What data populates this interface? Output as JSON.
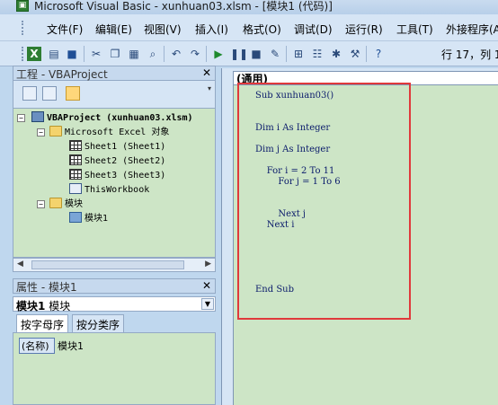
{
  "window": {
    "title": "Microsoft Visual Basic - xunhuan03.xlsm - [模块1 (代码)]"
  },
  "menu": [
    "文件(F)",
    "编辑(E)",
    "视图(V)",
    "插入(I)",
    "格式(O)",
    "调试(D)",
    "运行(R)",
    "工具(T)",
    "外接程序(A)"
  ],
  "toolbar": {
    "icons": [
      "excel-icon",
      "insert-form-icon",
      "save-icon",
      "cut-icon",
      "copy-icon",
      "paste-icon",
      "find-icon",
      "undo-icon",
      "redo-icon",
      "run-icon",
      "break-icon",
      "reset-icon",
      "design-mode-icon",
      "project-explorer-icon",
      "properties-icon",
      "object-browser-icon",
      "toolbox-icon",
      "help-icon"
    ],
    "position_text": "行 17，列 1"
  },
  "project_panel": {
    "title": "工程 - VBAProject",
    "close": "✕",
    "tree": {
      "project": "VBAProject (xunhuan03.xlsm)",
      "excel_objects_folder": "Microsoft Excel 对象",
      "sheets": [
        "Sheet1 (Sheet1)",
        "Sheet2 (Sheet2)",
        "Sheet3 (Sheet3)"
      ],
      "workbook": "ThisWorkbook",
      "modules_folder": "模块",
      "modules": [
        "模块1"
      ]
    }
  },
  "properties_panel": {
    "title": "属性 - 模块1",
    "close": "✕",
    "object_name": "模块1",
    "object_type": "模块",
    "tabs": [
      "按字母序",
      "按分类序"
    ],
    "rows": [
      {
        "name": "(名称)",
        "value": "模块1"
      }
    ]
  },
  "code_window": {
    "procedure_combo": "(通用)",
    "lines": [
      "Sub xunhuan03()",
      "",
      "",
      "Dim i As Integer",
      "",
      "Dim j As Integer",
      "",
      "    For i = 2 To 11",
      "        For j = 1 To 6",
      "",
      "",
      "        Next j",
      "    Next i",
      "",
      "",
      "",
      "",
      "",
      "End Sub"
    ]
  },
  "colors": {
    "code_bg": "#cde5c6",
    "highlight_border": "#e0393b",
    "selection": "#0a246a"
  }
}
